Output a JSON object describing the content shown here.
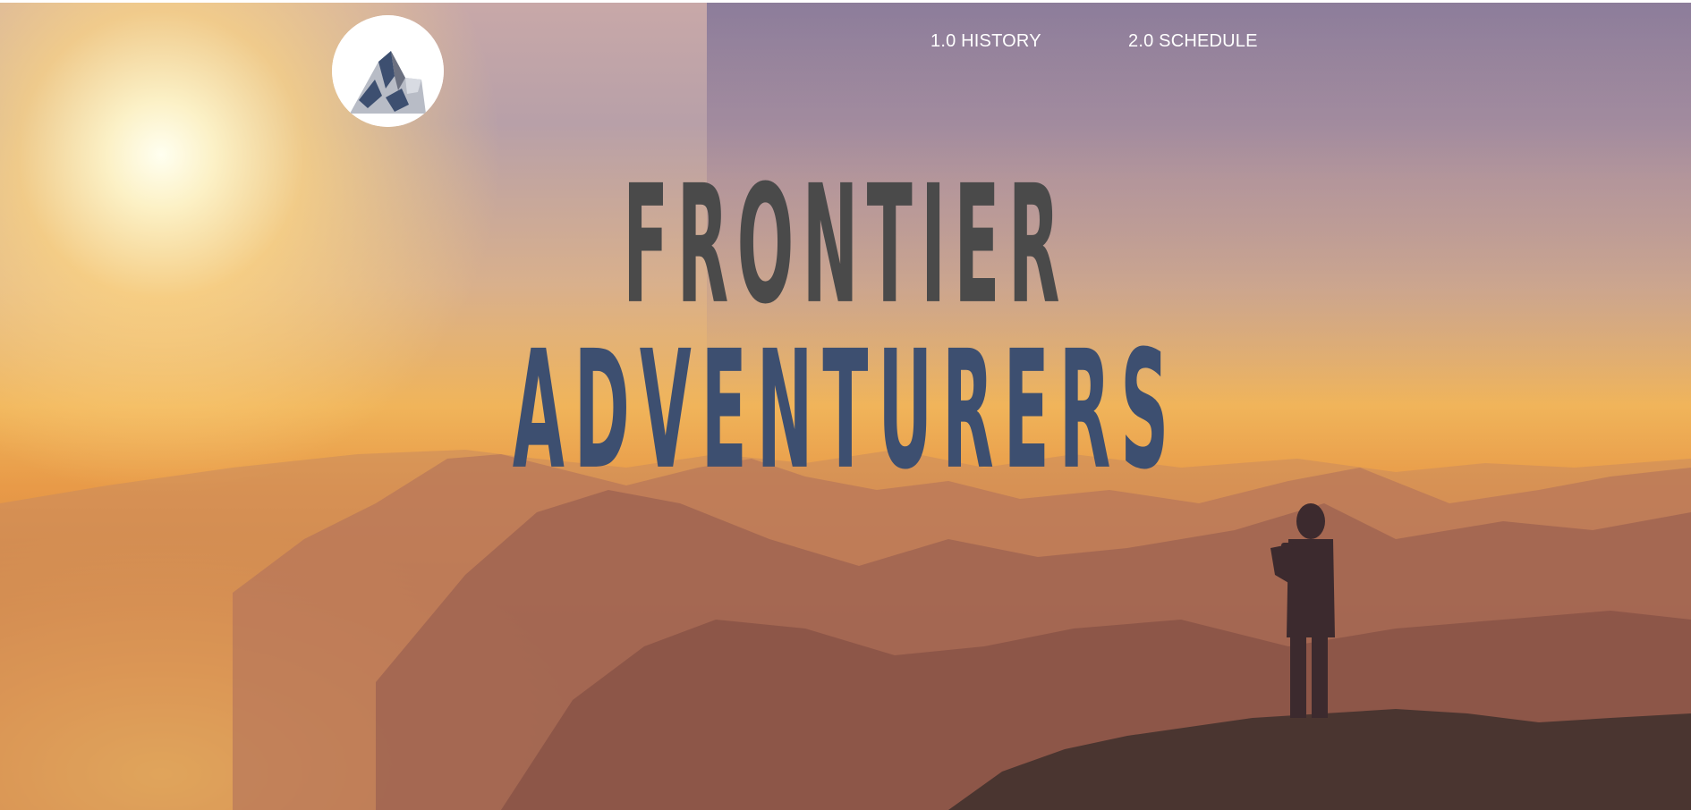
{
  "nav": {
    "items": [
      {
        "label": "1.0 HISTORY"
      },
      {
        "label": "2.0 SCHEDULE"
      }
    ]
  },
  "hero": {
    "title_line1": "FRONTIER",
    "title_line2": "ADVENTURERS",
    "background_image": "mountain-sunrise-hiker-photo"
  },
  "logo": {
    "icon": "mountain-logo-icon"
  },
  "colors": {
    "title_line1": "#4a4a4a",
    "title_line2": "#3d4f70",
    "nav_text": "#ffffff"
  }
}
